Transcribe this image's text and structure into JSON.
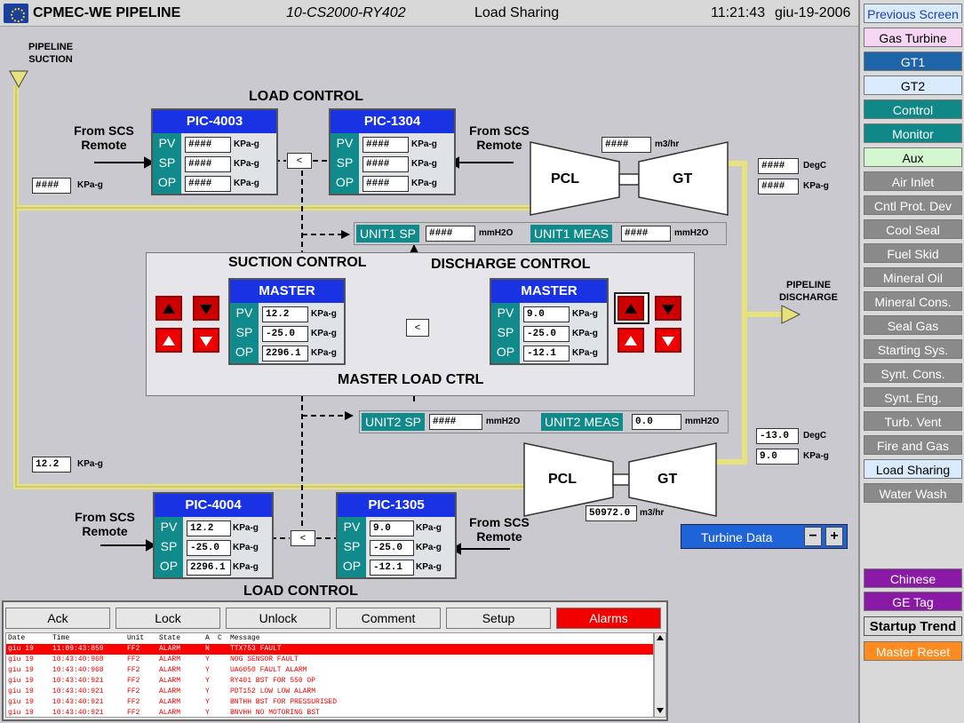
{
  "header": {
    "title": "CPMEC-WE PIPELINE",
    "tag": "10-CS2000-RY402",
    "screen": "Load Sharing",
    "time": "11:21:43",
    "date": "giu-19-2006"
  },
  "pipeline": {
    "suction_label": "PIPELINE SUCTION",
    "discharge_label": "PIPELINE DISCHARGE"
  },
  "top": {
    "load_control_label": "LOAD CONTROL",
    "from_scs_left": "From SCS Remote",
    "from_scs_right": "From SCS Remote",
    "suction_pressure": {
      "value": "####",
      "unit": "KPa-g"
    },
    "flow": {
      "value": "####",
      "unit": "m3/hr"
    },
    "temp": {
      "value": "####",
      "unit": "DegC"
    },
    "pressure": {
      "value": "####",
      "unit": "KPa-g"
    },
    "pic_left": {
      "name": "PIC-4003",
      "labels": [
        "PV",
        "SP",
        "OP"
      ],
      "values": [
        "####",
        "####",
        "####"
      ],
      "units": [
        "KPa-g",
        "KPa-g",
        "KPa-g"
      ]
    },
    "pic_right": {
      "name": "PIC-1304",
      "labels": [
        "PV",
        "SP",
        "OP"
      ],
      "values": [
        "####",
        "####",
        "####"
      ],
      "units": [
        "KPa-g",
        "KPa-g",
        "KPa-g"
      ]
    },
    "pcl": "PCL",
    "gt": "GT",
    "low_select": "<"
  },
  "unit1": {
    "sp_label": "UNIT1 SP",
    "sp_value": "####",
    "sp_unit": "mmH2O",
    "meas_label": "UNIT1 MEAS",
    "meas_value": "####",
    "meas_unit": "mmH2O"
  },
  "unit2": {
    "sp_label": "UNIT2 SP",
    "sp_value": "####",
    "sp_unit": "mmH2O",
    "meas_label": "UNIT2 MEAS",
    "meas_value": "0.0",
    "meas_unit": "mmH2O"
  },
  "master": {
    "suction_label": "SUCTION CONTROL",
    "discharge_label": "DISCHARGE CONTROL",
    "load_ctrl_label": "MASTER LOAD CTRL",
    "low_select": "<",
    "suction": {
      "name": "MASTER",
      "labels": [
        "PV",
        "SP",
        "OP"
      ],
      "values": [
        "12.2",
        "-25.0",
        "2296.1"
      ],
      "units": [
        "KPa-g",
        "KPa-g",
        "KPa-g"
      ]
    },
    "discharge": {
      "name": "MASTER",
      "labels": [
        "PV",
        "SP",
        "OP"
      ],
      "values": [
        "9.0",
        "-25.0",
        "-12.1"
      ],
      "units": [
        "KPa-g",
        "KPa-g",
        "KPa-g"
      ]
    }
  },
  "bottom": {
    "load_control_label": "LOAD CONTROL",
    "from_scs_left": "From SCS Remote",
    "from_scs_right": "From SCS Remote",
    "suction_pressure": {
      "value": "12.2",
      "unit": "KPa-g"
    },
    "flow": {
      "value": "50972.0",
      "unit": "m3/hr"
    },
    "temp": {
      "value": "-13.0",
      "unit": "DegC"
    },
    "pressure": {
      "value": "9.0",
      "unit": "KPa-g"
    },
    "pic_left": {
      "name": "PIC-4004",
      "labels": [
        "PV",
        "SP",
        "OP"
      ],
      "values": [
        "12.2",
        "-25.0",
        "2296.1"
      ],
      "units": [
        "KPa-g",
        "KPa-g",
        "KPa-g"
      ]
    },
    "pic_right": {
      "name": "PIC-1305",
      "labels": [
        "PV",
        "SP",
        "OP"
      ],
      "values": [
        "9.0",
        "-25.0",
        "-12.1"
      ],
      "units": [
        "KPa-g",
        "KPa-g",
        "KPa-g"
      ]
    },
    "pcl": "PCL",
    "gt": "GT",
    "low_select": "<"
  },
  "turbine_data": {
    "label": "Turbine Data",
    "minus": "−",
    "plus": "+"
  },
  "alarm_buttons": [
    "Ack",
    "Lock",
    "Unlock",
    "Comment",
    "Setup",
    "Alarms"
  ],
  "alarm_table": {
    "headers": [
      "Date",
      "Time",
      "Unit",
      "State",
      "A",
      "C",
      "Message"
    ],
    "rows": [
      [
        "giu 19",
        "11:09:43:859",
        "FF2",
        "ALARM",
        "N",
        "",
        "TTX753 FAULT"
      ],
      [
        "giu 19",
        "10:43:40:968",
        "FF2",
        "ALARM",
        "Y",
        "",
        "NOG SENSOR FAULT"
      ],
      [
        "giu 19",
        "10:43:40:968",
        "FF2",
        "ALARM",
        "Y",
        "",
        "UA6050 FAULT ALARM"
      ],
      [
        "giu 19",
        "10:43:40:921",
        "FF2",
        "ALARM",
        "Y",
        "",
        "RY401  BST FOR 550 OP"
      ],
      [
        "giu 19",
        "10:43:40:921",
        "FF2",
        "ALARM",
        "Y",
        "",
        "PDT152 LOW LOW ALARM"
      ],
      [
        "giu 19",
        "10:43:40:921",
        "FF2",
        "ALARM",
        "Y",
        "",
        "BNTHH BST FOR PRESSURISED"
      ],
      [
        "giu 19",
        "10:43:40:921",
        "FF2",
        "ALARM",
        "Y",
        "",
        "BNVHH NO MOTORING BST"
      ]
    ]
  },
  "sidebar": {
    "items": [
      {
        "label": "Previous Screen",
        "style": "light"
      },
      {
        "label": "Gas Turbine",
        "style": "pink"
      },
      {
        "label": "GT1",
        "style": "blue"
      },
      {
        "label": "GT2",
        "style": "light"
      },
      {
        "label": "Control",
        "style": "teal"
      },
      {
        "label": "Monitor",
        "style": "teal"
      },
      {
        "label": "Aux",
        "style": "green"
      },
      {
        "label": "Air Inlet",
        "style": "gray"
      },
      {
        "label": "Cntl Prot. Dev",
        "style": "gray"
      },
      {
        "label": "Cool Seal",
        "style": "gray"
      },
      {
        "label": "Fuel Skid",
        "style": "gray"
      },
      {
        "label": "Mineral Oil",
        "style": "gray"
      },
      {
        "label": "Mineral Cons.",
        "style": "gray"
      },
      {
        "label": "Seal Gas",
        "style": "gray"
      },
      {
        "label": "Starting Sys.",
        "style": "gray"
      },
      {
        "label": "Synt. Cons.",
        "style": "gray"
      },
      {
        "label": "Synt. Eng.",
        "style": "gray"
      },
      {
        "label": "Turb. Vent",
        "style": "gray"
      },
      {
        "label": "Fire and Gas",
        "style": "gray"
      },
      {
        "label": "Load Sharing",
        "style": "light"
      },
      {
        "label": "Water Wash",
        "style": "gray"
      }
    ],
    "bottom_items": [
      {
        "label": "Chinese",
        "style": "purple"
      },
      {
        "label": "GE Tag",
        "style": "purple"
      },
      {
        "label": "Startup Trend",
        "style": "bold"
      },
      {
        "label": "Master Reset",
        "style": "orange"
      }
    ]
  },
  "colors": {
    "background": "#c9c9cf",
    "pipe": "#e8e27a",
    "pic_header": "#1832e4",
    "teal": "#108a8a",
    "alarm_red": "#f20000"
  }
}
